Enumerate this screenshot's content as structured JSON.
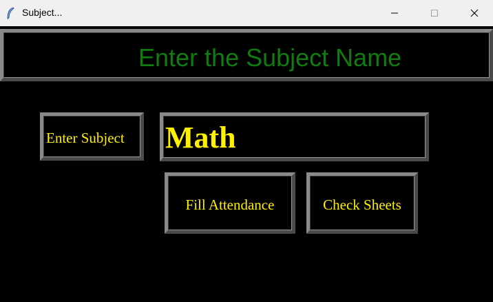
{
  "window": {
    "title": "Subject..."
  },
  "header": {
    "text": "Enter the Subject Name"
  },
  "form": {
    "enter_label": "Enter Subject",
    "subject_value": "Math"
  },
  "buttons": {
    "fill_attendance": "Fill Attendance",
    "check_sheets": "Check Sheets"
  },
  "colors": {
    "background": "#000000",
    "header_text": "#107c10",
    "label_text": "#ffef00"
  }
}
